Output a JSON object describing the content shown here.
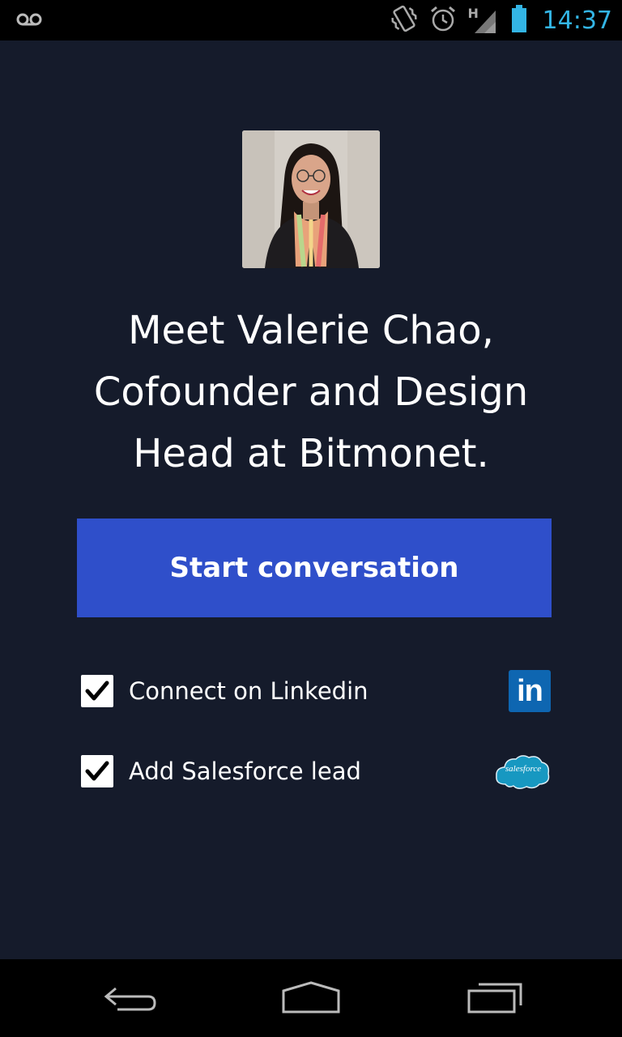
{
  "status_bar": {
    "time": "14:37",
    "network_type": "H",
    "icons": [
      "voicemail-icon",
      "vibrate-icon",
      "alarm-icon",
      "signal-icon",
      "battery-icon"
    ]
  },
  "profile": {
    "avatar_alt": "Valerie Chao",
    "headline_lines": [
      "Meet Valerie Chao,",
      "Cofounder and Design",
      "Head at Bitmonet."
    ]
  },
  "actions": {
    "start_label": "Start conversation"
  },
  "options": [
    {
      "label": "Connect on Linkedin",
      "checked": true,
      "service_icon": "linkedin-icon",
      "service_text": "in"
    },
    {
      "label": "Add Salesforce lead",
      "checked": true,
      "service_icon": "salesforce-icon",
      "service_text": "salesforce"
    }
  ],
  "nav_bar": {
    "icons": [
      "back-icon",
      "home-icon",
      "recent-apps-icon"
    ]
  },
  "colors": {
    "background": "#151b2b",
    "button": "#2f4fca",
    "clock": "#33b5e5",
    "linkedin": "#0e66b1",
    "salesforce": "#1798c1"
  }
}
